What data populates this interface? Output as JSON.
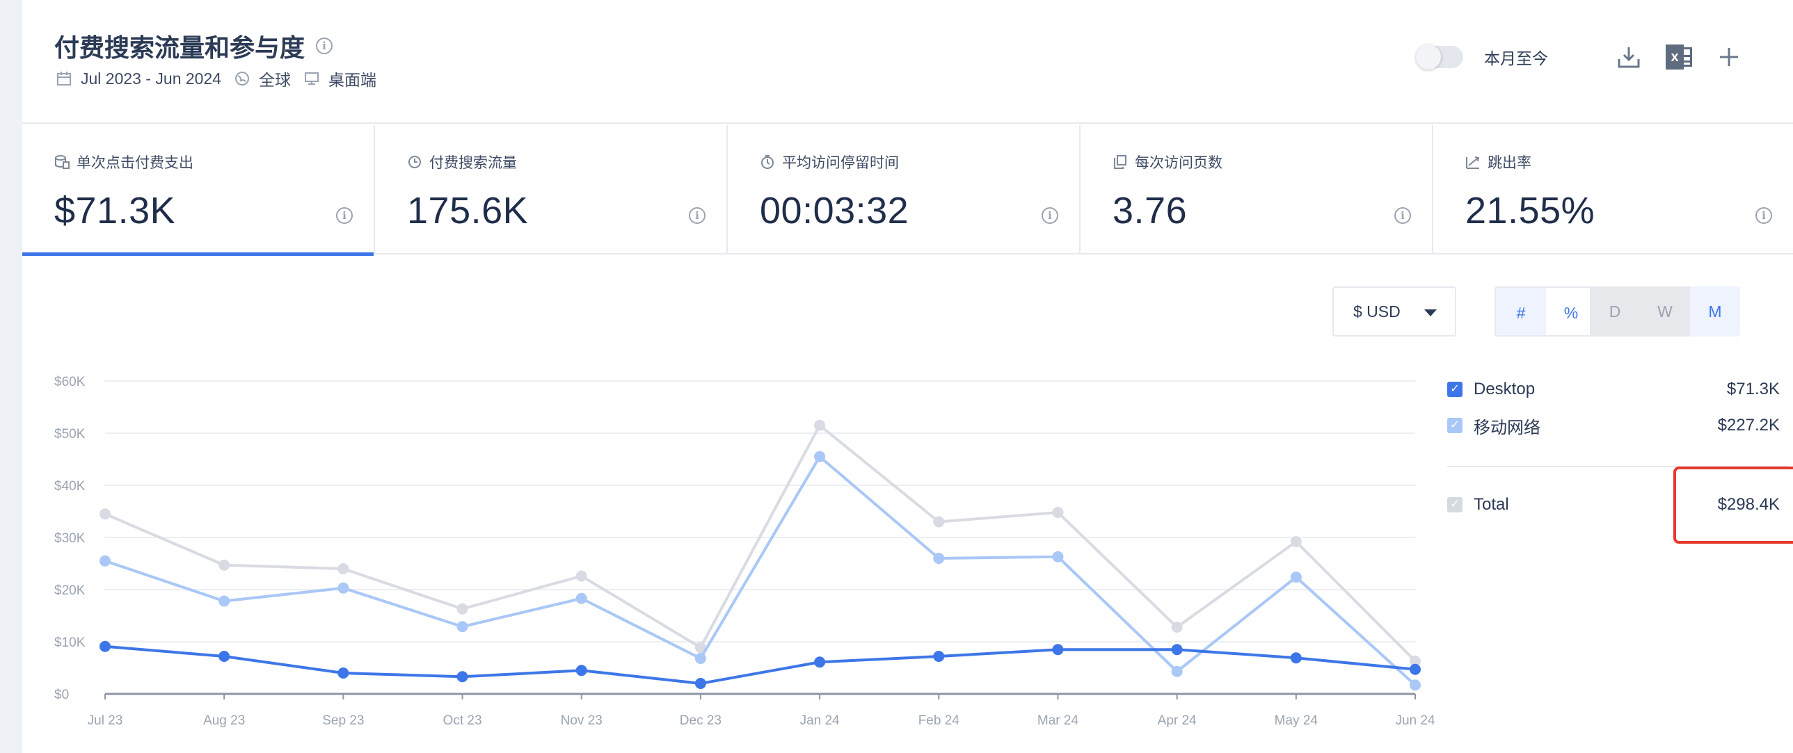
{
  "header": {
    "title": "付费搜索流量和参与度",
    "date_range": "Jul 2023 - Jun 2024",
    "region": "全球",
    "device": "桌面端",
    "toggle_label": "本月至今",
    "icons": [
      "calendar-icon",
      "globe-icon",
      "monitor-icon",
      "download-icon",
      "excel-icon",
      "plus-icon",
      "info-icon"
    ]
  },
  "metrics": [
    {
      "label": "单次点击付费支出",
      "value": "$71.3K",
      "icon": "cost-icon",
      "active": true
    },
    {
      "label": "付费搜索流量",
      "value": "175.6K",
      "icon": "clock-icon",
      "active": false
    },
    {
      "label": "平均访问停留时间",
      "value": "00:03:32",
      "icon": "timer-icon",
      "active": false
    },
    {
      "label": "每次访问页数",
      "value": "3.76",
      "icon": "pages-icon",
      "active": false
    },
    {
      "label": "跳出率",
      "value": "21.55%",
      "icon": "bounce-icon",
      "active": false
    }
  ],
  "controls": {
    "currency": "$ USD",
    "format_options": [
      "#",
      "%"
    ],
    "format_selected": "#",
    "granularity_options": [
      "D",
      "W",
      "M"
    ],
    "granularity_selected": "M"
  },
  "legend": {
    "items": [
      {
        "name": "Desktop",
        "value": "$71.3K",
        "checkbox_color": "#3d76e8"
      },
      {
        "name": "移动网络",
        "value": "$227.2K",
        "checkbox_color": "#a9c7f7"
      }
    ],
    "total": {
      "name": "Total",
      "value": "$298.4K",
      "checkbox_color": "#d5d9e0"
    }
  },
  "chart_data": {
    "type": "line",
    "x": [
      "Jul 23",
      "Aug 23",
      "Sep 23",
      "Oct 23",
      "Nov 23",
      "Dec 23",
      "Jan 24",
      "Feb 24",
      "Mar 24",
      "Apr 24",
      "May 24",
      "Jun 24"
    ],
    "y_ticks": [
      "$0",
      "$10K",
      "$20K",
      "$30K",
      "$40K",
      "$50K",
      "$60K"
    ],
    "ylim": [
      0,
      60000
    ],
    "series": [
      {
        "name": "Total",
        "color": "#d9dbe3",
        "values": [
          34500,
          24700,
          24000,
          16300,
          22600,
          8900,
          51500,
          33000,
          34800,
          12800,
          29200,
          6300
        ]
      },
      {
        "name": "移动网络",
        "color": "#a9c7f7",
        "values": [
          25500,
          17800,
          20300,
          12900,
          18300,
          6800,
          45500,
          26000,
          26300,
          4300,
          22400,
          1700
        ]
      },
      {
        "name": "Desktop",
        "color": "#3d76e8",
        "values": [
          9100,
          7200,
          4000,
          3300,
          4500,
          2000,
          6100,
          7200,
          8500,
          8500,
          6900,
          4700
        ]
      }
    ],
    "grid": true
  }
}
